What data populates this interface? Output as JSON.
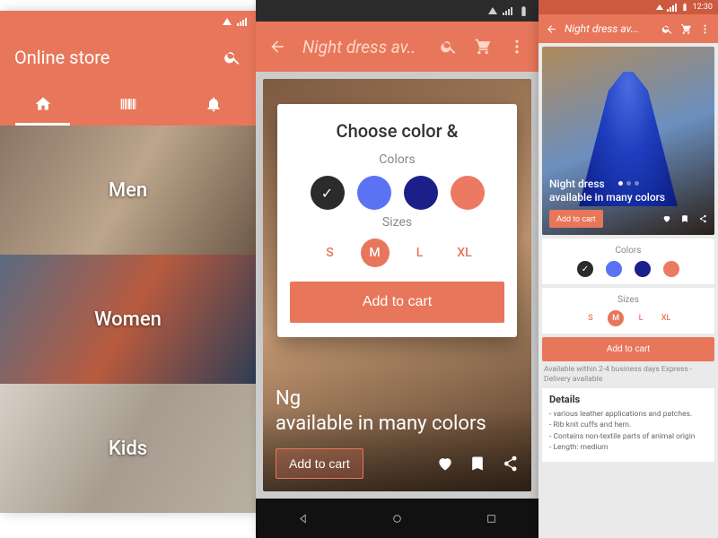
{
  "colors": {
    "accent": "#e8765a",
    "blue": "#5b72f4",
    "navy": "#1b1f8a",
    "coral": "#ec7a62",
    "black": "#2b2b2b"
  },
  "phone1": {
    "title": "Online store",
    "categories": [
      {
        "label": "Men"
      },
      {
        "label": "Women"
      },
      {
        "label": "Kids"
      }
    ]
  },
  "tablet": {
    "title": "Night dress av..",
    "hero_line1": "Ng",
    "hero_line2": "available in many colors",
    "hero_cta": "Add to cart",
    "modal": {
      "title": "Choose color &",
      "colors_label": "Colors",
      "sizes_label": "Sizes",
      "swatches": [
        "#2b2b2b",
        "#5b72f4",
        "#1b1f8a",
        "#ec7a62"
      ],
      "selected_color_index": 0,
      "sizes": [
        "S",
        "M",
        "L",
        "XL"
      ],
      "selected_size": "M",
      "cta": "Add to cart"
    }
  },
  "phone2": {
    "clock": "12:30",
    "title": "Night dress av...",
    "hero_line1": "Night dress",
    "hero_line2": "available in many colors",
    "hero_cta": "Add to cart",
    "page_dots": 3,
    "active_dot": 0,
    "colors_label": "Colors",
    "sizes_label": "Sizes",
    "swatches": [
      "#2b2b2b",
      "#5b72f4",
      "#1b1f8a",
      "#ec7a62"
    ],
    "selected_color_index": 0,
    "sizes": [
      "S",
      "M",
      "L",
      "XL"
    ],
    "selected_size": "M",
    "cta": "Add to cart",
    "shipping": "Available within 2-4 business days Express -Delivery available",
    "details_heading": "Details",
    "details": [
      "various leather applications and patches.",
      "Rib knit cuffs and hem.",
      "Contains non-textile parts of animal origin",
      "Length: medium"
    ]
  }
}
